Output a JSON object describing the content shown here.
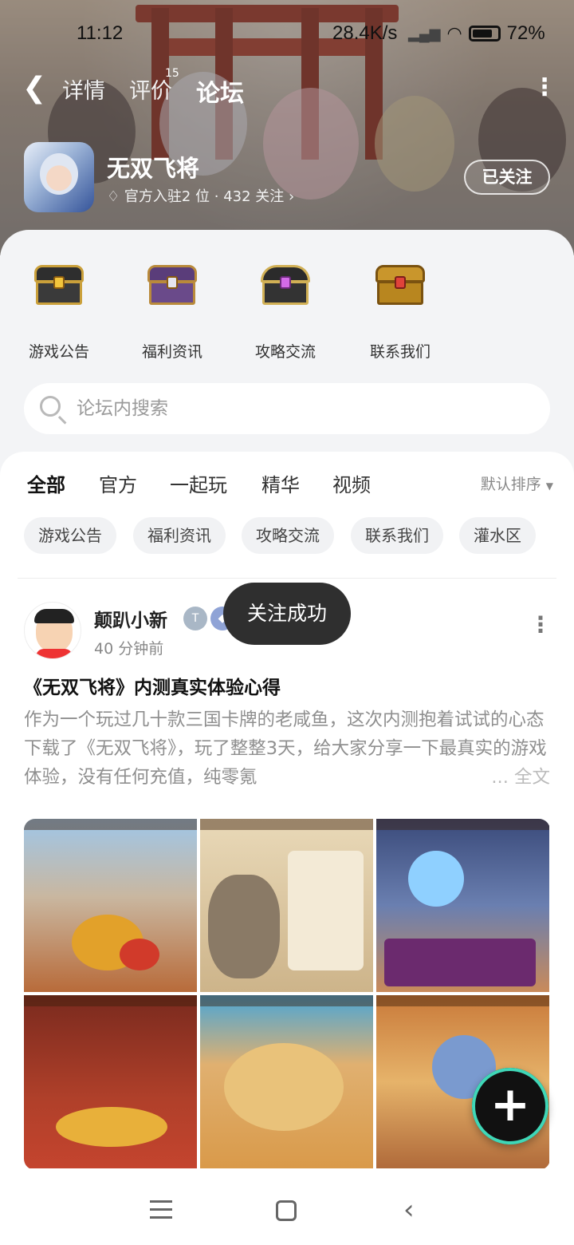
{
  "status_bar": {
    "time": "11:12",
    "network_speed": "28.4K/s",
    "battery": "72%"
  },
  "nav": {
    "tabs": [
      {
        "label": "详情"
      },
      {
        "label": "评价",
        "count": "15"
      },
      {
        "label": "论坛"
      }
    ],
    "active_tab": "论坛"
  },
  "game": {
    "name": "无双飞将",
    "meta": "官方入驻2 位 · 432 关注",
    "follow_label": "已关注"
  },
  "categories": [
    {
      "label": "游戏公告",
      "icon": "gold-black-chest-icon"
    },
    {
      "label": "福利资讯",
      "icon": "purple-chest-icon"
    },
    {
      "label": "攻略交流",
      "icon": "gem-chest-icon"
    },
    {
      "label": "联系我们",
      "icon": "gold-chest-icon"
    }
  ],
  "search": {
    "placeholder": "论坛内搜索"
  },
  "feed_tabs": [
    {
      "label": "全部"
    },
    {
      "label": "官方"
    },
    {
      "label": "一起玩"
    },
    {
      "label": "精华"
    },
    {
      "label": "视频"
    }
  ],
  "sort_label": "默认排序",
  "chips": [
    {
      "label": "游戏公告"
    },
    {
      "label": "福利资讯"
    },
    {
      "label": "攻略交流"
    },
    {
      "label": "联系我们"
    },
    {
      "label": "灌水区"
    }
  ],
  "post": {
    "author": "颠趴小新",
    "time": "40 分钟前",
    "title": "《无双飞将》内测真实体验心得",
    "body": "作为一个玩过几十款三国卡牌的老咸鱼，这次内测抱着试试的心态下载了《无双飞将》，玩了整整3天，给大家分享一下最真实的游戏体验，没有任何充值，纯零氪",
    "more_label": "... 全文",
    "images": [
      {
        "desc": "city-loot-screenshot"
      },
      {
        "desc": "player-info-screenshot"
      },
      {
        "desc": "battle-screenshot"
      },
      {
        "desc": "hall-screenshot"
      },
      {
        "desc": "map-screenshot"
      },
      {
        "desc": "desert-battle-screenshot"
      }
    ]
  },
  "toast": "关注成功",
  "colors": {
    "accent": "#3fd7b7",
    "toast_bg": "#2f2f2f"
  }
}
